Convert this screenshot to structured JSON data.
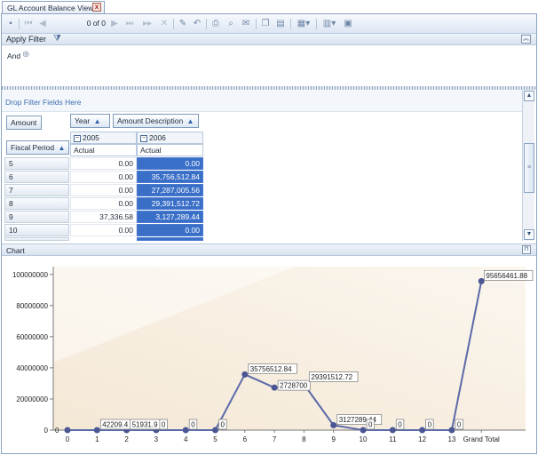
{
  "window": {
    "tab_title": "GL Account Balance View",
    "close_glyph": "x"
  },
  "toolbar": {
    "record_indicator": "0 of 0",
    "icons": [
      "save-icon",
      "first-record-icon",
      "previous-record-icon",
      "next-record-icon",
      "last-record-icon",
      "next-page-icon",
      "delete-icon",
      "edit-icon",
      "undo-icon",
      "print-preview-icon",
      "find-icon",
      "mail-icon",
      "copy-icon",
      "paste-icon",
      "export-icon",
      "chart-type-icon",
      "options-icon"
    ]
  },
  "filter": {
    "title": "Apply Filter",
    "operator": "And"
  },
  "pivot": {
    "drop_hint": "Drop Filter Fields Here",
    "data_field": "Amount",
    "column_fields": [
      {
        "label": "Year",
        "sort": "▲"
      },
      {
        "label": "Amount Description",
        "sort": "▲"
      }
    ],
    "row_field": {
      "label": "Fiscal Period",
      "sort": "▲"
    },
    "years": [
      {
        "label": "2005",
        "sub": "Actual"
      },
      {
        "label": "2006",
        "sub": "Actual"
      }
    ],
    "rows": [
      {
        "period": "5",
        "y2005": "0.00",
        "y2006": "0.00"
      },
      {
        "period": "6",
        "y2005": "0.00",
        "y2006": "35,756,512.84"
      },
      {
        "period": "7",
        "y2005": "0.00",
        "y2006": "27,287,005.56"
      },
      {
        "period": "8",
        "y2005": "0.00",
        "y2006": "29,391,512.72"
      },
      {
        "period": "9",
        "y2005": "37,336.58",
        "y2006": "3,127,289.44"
      },
      {
        "period": "10",
        "y2005": "0.00",
        "y2006": "0.00"
      }
    ]
  },
  "chart_panel": {
    "title": "Chart"
  },
  "chart_data": {
    "type": "line",
    "categories": [
      "0",
      "1",
      "2",
      "3",
      "4",
      "5",
      "6",
      "7",
      "8",
      "9",
      "10",
      "11",
      "12",
      "13",
      "Grand Total"
    ],
    "values": [
      0,
      0,
      0,
      0,
      0,
      0,
      35756512.84,
      27287005.56,
      29391512.72,
      3127289.44,
      0,
      0,
      0,
      0,
      95656461.88
    ],
    "data_labels": [
      "",
      "42209.4",
      "51931.9",
      "0",
      "0",
      "0",
      "35756512.84",
      "2728700",
      "29391512.72",
      "3127289.44",
      "0",
      "0",
      "0",
      "0",
      "95656461.88"
    ],
    "first_label": "0",
    "y_ticks": [
      "0",
      "20000000",
      "40000000",
      "60000000",
      "80000000",
      "100000000"
    ],
    "ylim": [
      0,
      105000000
    ],
    "grid": false,
    "colors": {
      "line": "#5b6aa8",
      "point": "#4a5794",
      "plot_bg": "#f6ecdc"
    }
  }
}
